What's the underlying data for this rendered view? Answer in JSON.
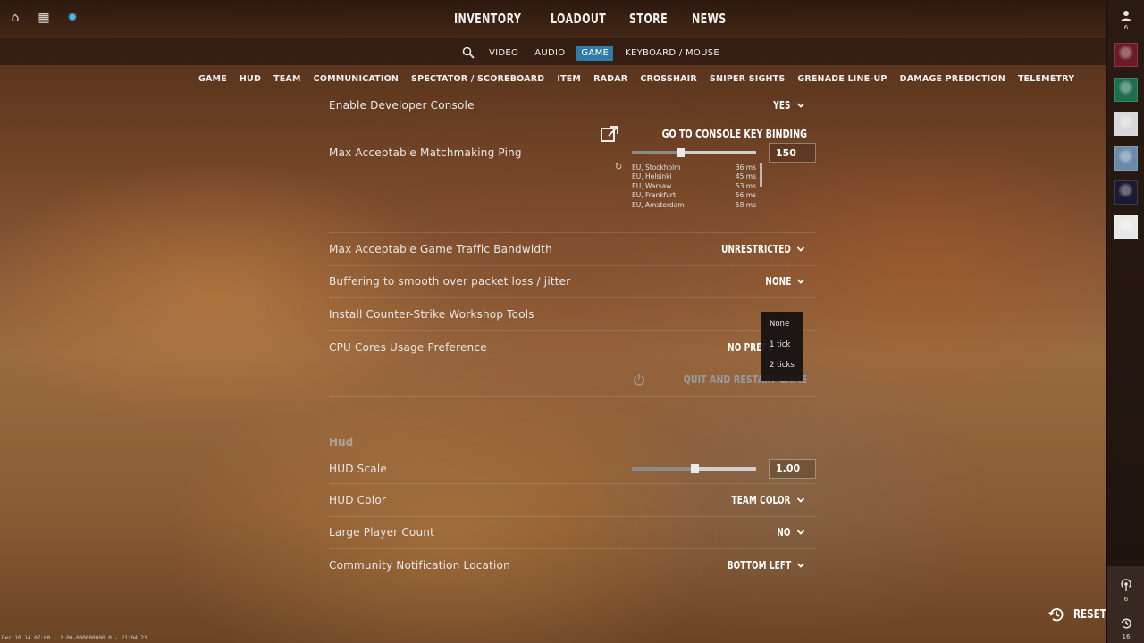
{
  "top_icons": [
    {
      "name": "home-icon",
      "glyph": "⌂"
    },
    {
      "name": "tv-icon",
      "glyph": "▦"
    },
    {
      "name": "gear-icon",
      "glyph": "✹"
    }
  ],
  "main_nav": [
    "INVENTORY",
    "LOADOUT",
    "STORE",
    "NEWS"
  ],
  "sub_nav": [
    "VIDEO",
    "AUDIO",
    "GAME",
    "KEYBOARD / MOUSE"
  ],
  "sub_nav_active": "GAME",
  "category_tabs": [
    "GAME",
    "HUD",
    "TEAM",
    "COMMUNICATION",
    "SPECTATOR / SCOREBOARD",
    "ITEM",
    "RADAR",
    "CROSSHAIR",
    "SNIPER SIGHTS",
    "GRENADE LINE-UP",
    "DAMAGE PREDICTION",
    "TELEMETRY"
  ],
  "settings": {
    "dev_console": {
      "label": "Enable Developer Console",
      "value": "YES"
    },
    "console_key_link": "GO TO CONSOLE KEY BINDING",
    "matchmaking_ping": {
      "label": "Max Acceptable Matchmaking Ping",
      "value": "150",
      "slider_fraction": 0.39,
      "servers": [
        {
          "name": "EU, Stockholm",
          "ping": "36 ms"
        },
        {
          "name": "EU, Helsinki",
          "ping": "45 ms"
        },
        {
          "name": "EU, Warsaw",
          "ping": "53 ms"
        },
        {
          "name": "EU, Frankfurt",
          "ping": "56 ms"
        },
        {
          "name": "EU, Amsterdam",
          "ping": "58 ms"
        }
      ]
    },
    "bandwidth": {
      "label": "Max Acceptable Game Traffic Bandwidth",
      "value": "UNRESTRICTED"
    },
    "buffering": {
      "label": "Buffering to smooth over packet loss / jitter",
      "value": "NONE"
    },
    "workshop": {
      "label": "Install Counter-Strike Workshop Tools"
    },
    "cpu_cores": {
      "label": "CPU Cores Usage Preference",
      "value": "NO PREFE"
    },
    "quit_restart": "QUIT AND RESTART GAME"
  },
  "buffering_options": [
    "None",
    "1 tick",
    "2 ticks"
  ],
  "hud": {
    "section_title": "Hud",
    "scale": {
      "label": "HUD Scale",
      "value": "1.00",
      "slider_fraction": 0.5
    },
    "color": {
      "label": "HUD Color",
      "value": "TEAM COLOR"
    },
    "large_player_count": {
      "label": "Large Player Count",
      "value": "NO"
    },
    "notification_location": {
      "label": "Community Notification Location",
      "value": "BOTTOM LEFT"
    }
  },
  "sidebar": {
    "friends_count": "6",
    "broadcast_count": "6",
    "history_count": "16",
    "avatar_colors": [
      "#6a1a24",
      "#1e6e4e",
      "#d8d8d8",
      "#6a8aa8",
      "#1a1a30",
      "#e8e8e8"
    ]
  },
  "reset_label": "RESET",
  "debug_text": "Dec 10 14 07:00 - 2.00-000000000.0 - 21:04:23"
}
